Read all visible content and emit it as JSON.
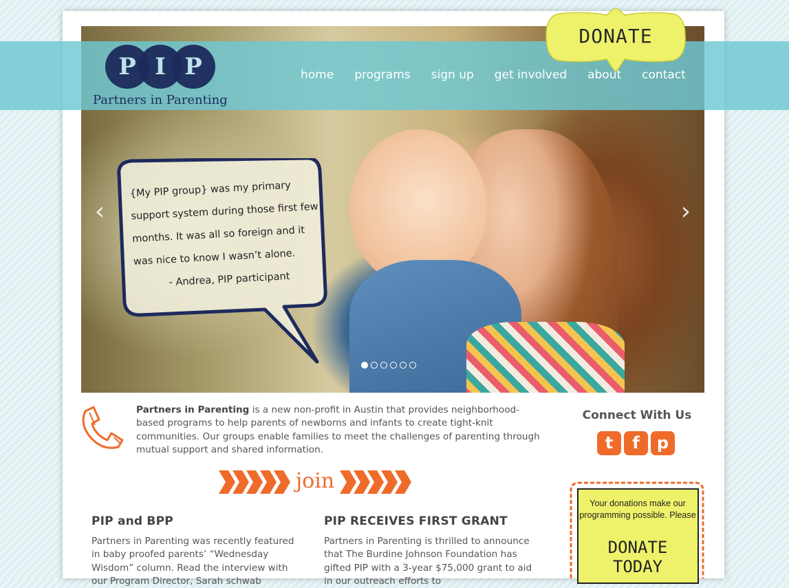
{
  "brand": {
    "logo_letters": [
      "P",
      "I",
      "P"
    ],
    "name": "Partners in Parenting",
    "band_color": "#6ec8d4",
    "accent": "#ef6b2a",
    "navy": "#1d2a5c"
  },
  "nav": {
    "items": [
      "home",
      "programs",
      "sign up",
      "get involved",
      "about",
      "contact"
    ]
  },
  "donate_tag": {
    "label": "DONATE"
  },
  "slider": {
    "quote_lines": [
      "{My PIP group} was my primary",
      "support system during those first few",
      "months. It was all so foreign and it",
      "was nice to know I wasn’t alone."
    ],
    "attribution": "- Andrea, PIP participant",
    "prev_icon": "chevron-left-icon",
    "next_icon": "chevron-right-icon",
    "slide_count": 6,
    "active_slide": 1
  },
  "intro": {
    "bold": "Partners in Parenting",
    "text": " is a new non-profit in Austin that provides neighborhood-based programs to help parents of newborns and infants to create tight-knit communities. Our groups enable families to meet the challenges of parenting through mutual support and shared information."
  },
  "join": {
    "label": "join"
  },
  "news": [
    {
      "title": "PIP and BPP",
      "body": "Partners in Parenting was recently featured in baby proofed parents’ “Wednesday Wisdom” column. Read the interview with our Program Director, Sarah schwab"
    },
    {
      "title": "PIP RECEIVES FIRST GRANT",
      "body": "Partners in Parenting is thrilled to announce that The Burdine Johnson Foundation has gifted PIP with a 3-year $75,000 grant to aid in our outreach efforts to"
    }
  ],
  "connect": {
    "title": "Connect With Us",
    "icons": [
      "twitter-icon",
      "facebook-icon",
      "pinterest-icon"
    ],
    "glyphs": [
      "t",
      "f",
      "p"
    ]
  },
  "donate_box": {
    "text": "Your donations make our programming possible. Please",
    "cta": "DONATE TODAY"
  }
}
